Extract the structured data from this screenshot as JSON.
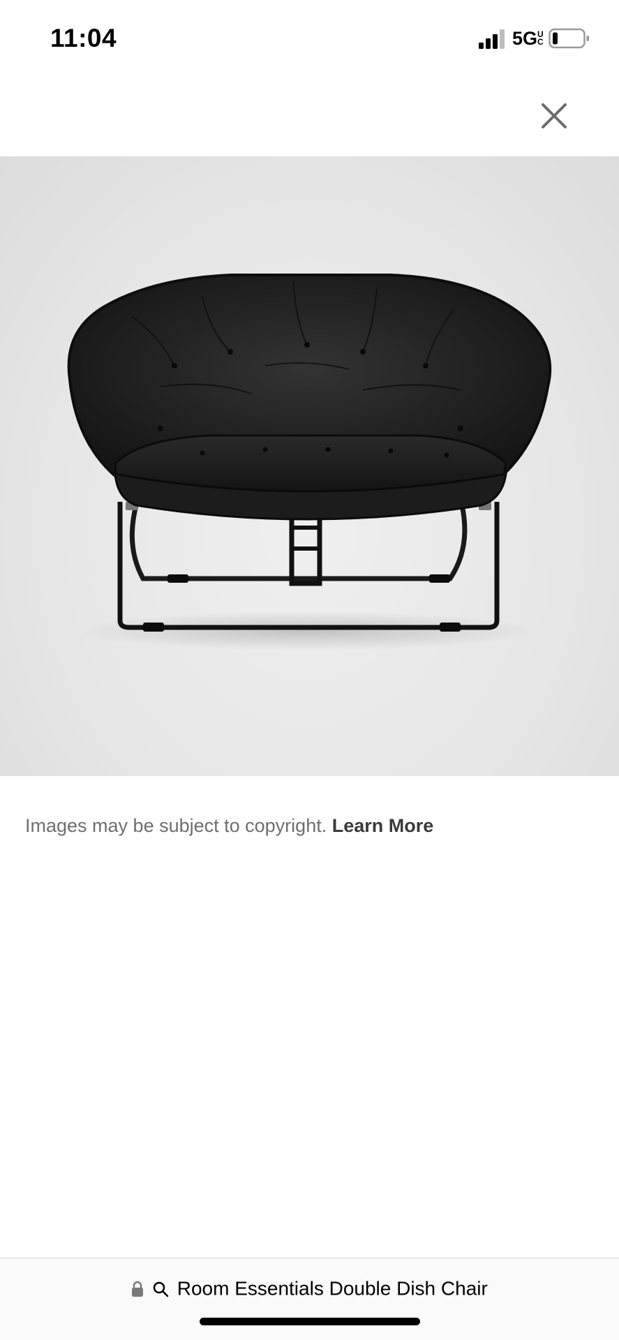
{
  "status_bar": {
    "time": "11:04",
    "network": "5G",
    "network_suffix": "UC",
    "signal_icon": "cellular-signal-icon",
    "battery_icon": "battery-icon"
  },
  "header": {
    "close_icon": "close-icon"
  },
  "image": {
    "description_icon": "product-photo-double-dish-chair",
    "background_color": "#e6e6e6"
  },
  "copyright": {
    "text": "Images may be subject to copyright.",
    "link_label": "Learn More"
  },
  "address_bar": {
    "lock_icon": "lock-icon",
    "search_icon": "search-icon",
    "query": "Room Essentials Double Dish Chair"
  }
}
